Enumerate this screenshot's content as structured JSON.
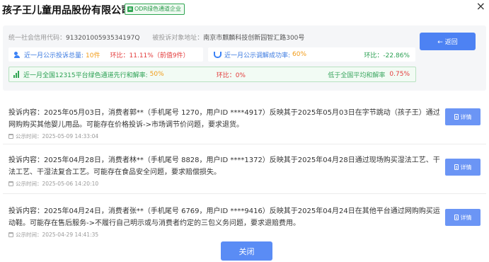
{
  "header": {
    "company_name": "孩子王儿童用品股份有限公司",
    "badge_label": "ODR绿色通道企业",
    "close_symbol": "×"
  },
  "info": {
    "credit_code_label": "统一社会信用代码：",
    "credit_code": "91320100593534197Q",
    "address_label": "被投诉对象地址：",
    "address": "南京市麒麟科技创新园智汇路300号",
    "back_label": "← 返回"
  },
  "stats": {
    "complaints": {
      "label": "近一月公示投诉总量:",
      "value": "10件",
      "ratio": "环比：11.11%（前值9件）"
    },
    "mediation": {
      "label": "近一月公示调解成功率:",
      "value": "60%",
      "ratio": "环比：-22.86%"
    },
    "green_channel": {
      "label": "近一月全国12315平台绿色通道先行和解率:",
      "value": "50%",
      "ratio": "环比：0%",
      "national": "低于全国平均和解率",
      "national_value": "0.75%"
    }
  },
  "complaints": [
    {
      "text": "投诉内容：2025年05月03日，消费者郭**（手机尾号 1270，用户ID ****4917）反映其于2025年05月03日在字节跳动（孩子王）通过网购购买其他婴儿用品。可能存在价格投诉->市场调节价问题，要求退货。",
      "publish_time": "公示时间：2025-05-09 14:33:04",
      "detail_label": "详情"
    },
    {
      "text": "投诉内容：2025年04月28日，消费者林**（手机尾号 8828，用户ID ****1372）反映其于2025年04月28日通过现场购买湿法工艺、干法工艺、干湿法复合工艺。可能存在食品安全问题，要求赔偿损失。",
      "publish_time": "公示时间：2025-05-06 14:20:10",
      "detail_label": "详情"
    },
    {
      "text": "投诉内容：2025年04月24日，消费者张**（手机尾号 6769，用户ID ****9416）反映其于2025年04月24日在其他平台通过网购购买运动鞋。可能存在售后服务->不履行自己明示或与消费者约定的三包义务问题，要求退赔费用。",
      "publish_time": "公示时间：2025-04-29 14:41:35",
      "detail_label": "详情"
    }
  ],
  "footer": {
    "close_label": "关闭"
  },
  "colors": {
    "primary_blue": "#4d82f3",
    "green": "#2fa552",
    "orange": "#f29b16",
    "red": "#e33b3b"
  }
}
